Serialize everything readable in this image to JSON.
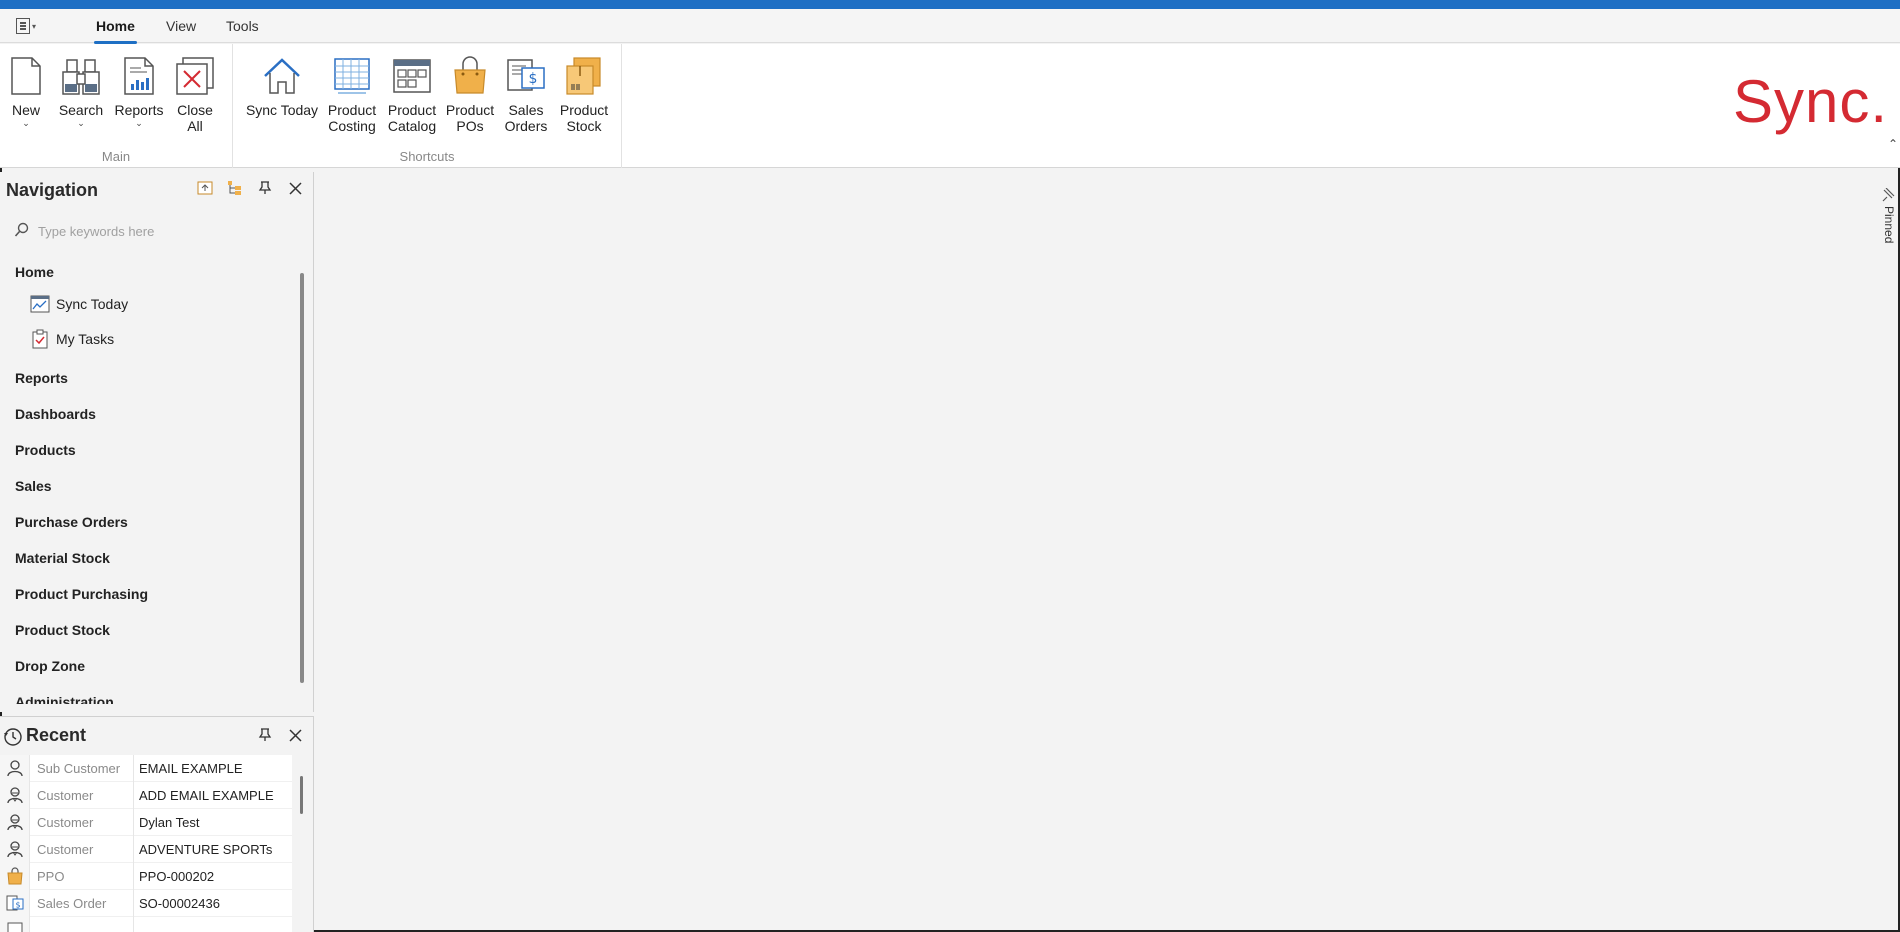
{
  "tabs": [
    {
      "label": "Home",
      "active": true
    },
    {
      "label": "View",
      "active": false
    },
    {
      "label": "Tools",
      "active": false
    }
  ],
  "ribbon": {
    "main_group": {
      "label": "Main",
      "buttons": [
        {
          "label": "New",
          "icon": "new-document-icon",
          "has_dropdown": true
        },
        {
          "label": "Search",
          "icon": "binoculars-icon",
          "has_dropdown": true
        },
        {
          "label": "Reports",
          "icon": "report-icon",
          "has_dropdown": true
        },
        {
          "label": "Close\nAll",
          "icon": "close-all-icon",
          "has_dropdown": false
        }
      ]
    },
    "shortcuts_group": {
      "label": "Shortcuts",
      "buttons": [
        {
          "label": "Sync Today",
          "icon": "home-icon"
        },
        {
          "label": "Product\nCosting",
          "icon": "spreadsheet-icon"
        },
        {
          "label": "Product\nCatalog",
          "icon": "catalog-icon"
        },
        {
          "label": "Product\nPOs",
          "icon": "shopping-bag-icon"
        },
        {
          "label": "Sales\nOrders",
          "icon": "sales-order-icon"
        },
        {
          "label": "Product\nStock",
          "icon": "stock-box-icon"
        }
      ]
    }
  },
  "logo_text": "Sync.",
  "brand_color": "#d42a32",
  "accent_color": "#1e6fc4",
  "navigation": {
    "title": "Navigation",
    "search_placeholder": "Type keywords here",
    "groups": [
      {
        "label": "Home",
        "items": [
          {
            "label": "Sync Today",
            "icon": "dashboard-chart-icon"
          },
          {
            "label": "My Tasks",
            "icon": "clipboard-check-icon"
          }
        ]
      },
      {
        "label": "Reports"
      },
      {
        "label": "Dashboards"
      },
      {
        "label": "Products"
      },
      {
        "label": "Sales"
      },
      {
        "label": "Purchase Orders"
      },
      {
        "label": "Material Stock"
      },
      {
        "label": "Product Purchasing"
      },
      {
        "label": "Product Stock"
      },
      {
        "label": "Drop Zone"
      },
      {
        "label": "Administration"
      }
    ]
  },
  "recent": {
    "title": "Recent",
    "rows": [
      {
        "icon": "person-icon",
        "type": "Sub Customer",
        "value": "EMAIL EXAMPLE"
      },
      {
        "icon": "customer-icon",
        "type": "Customer",
        "value": "ADD EMAIL EXAMPLE"
      },
      {
        "icon": "customer-icon",
        "type": "Customer",
        "value": "Dylan Test"
      },
      {
        "icon": "customer-icon",
        "type": "Customer",
        "value": "ADVENTURE SPORTs"
      },
      {
        "icon": "shopping-bag-icon",
        "type": "PPO",
        "value": "PPO-000202"
      },
      {
        "icon": "sales-order-icon",
        "type": "Sales Order",
        "value": "SO-00002436"
      }
    ]
  },
  "pinned_label": "Pinned"
}
